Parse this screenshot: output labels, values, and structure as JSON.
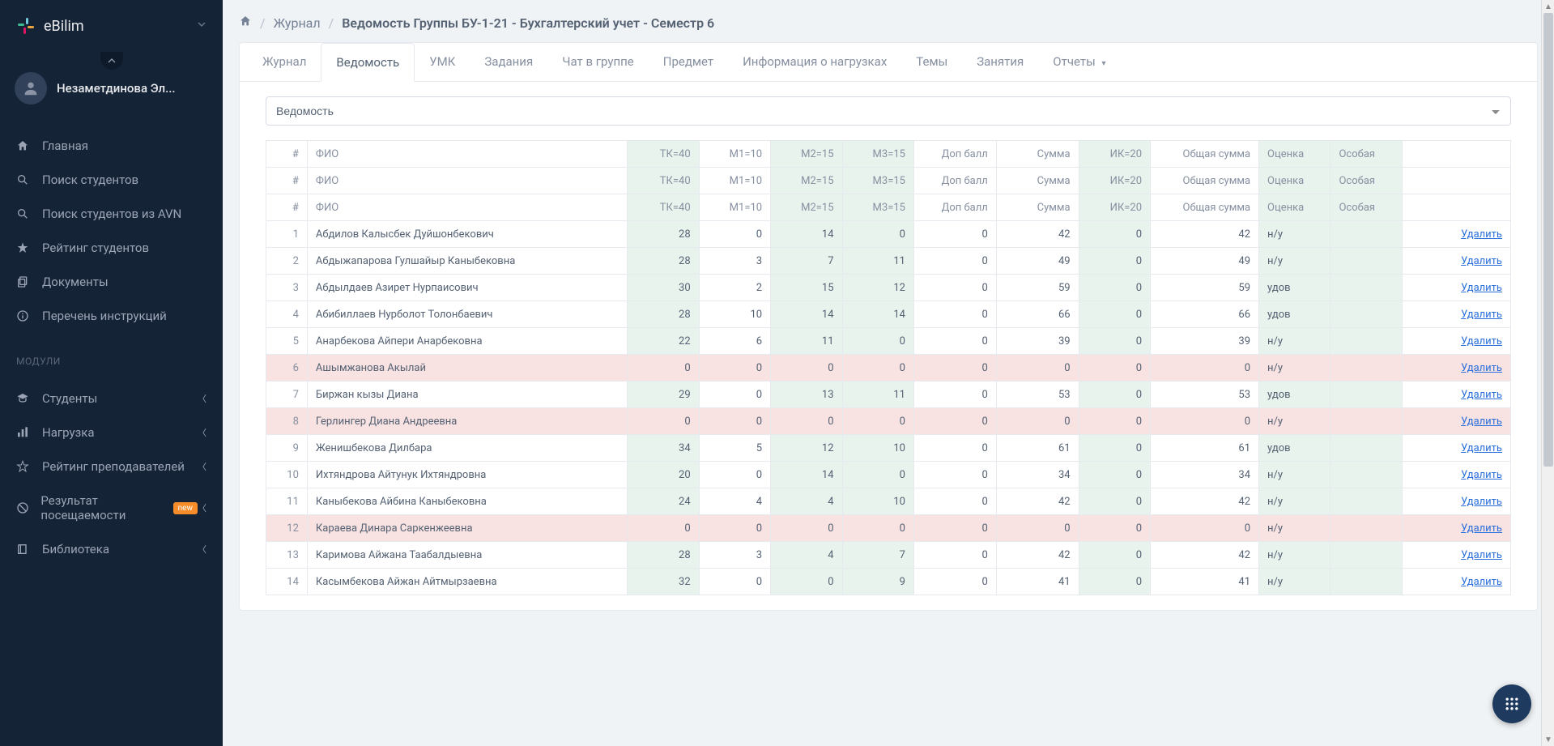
{
  "brand": {
    "name": "eBilim"
  },
  "user": {
    "name": "Незаметдинова Эл..."
  },
  "sidebar": {
    "items": [
      {
        "icon": "home",
        "label": "Главная"
      },
      {
        "icon": "search",
        "label": "Поиск студентов"
      },
      {
        "icon": "search",
        "label": "Поиск студентов из AVN"
      },
      {
        "icon": "star",
        "label": "Рейтинг студентов"
      },
      {
        "icon": "copy",
        "label": "Документы"
      },
      {
        "icon": "info",
        "label": "Перечень инструкций"
      }
    ],
    "section_label": "МОДУЛИ",
    "modules": [
      {
        "icon": "grad",
        "label": "Студенты",
        "arrow": true
      },
      {
        "icon": "chart",
        "label": "Нагрузка",
        "arrow": true
      },
      {
        "icon": "star-o",
        "label": "Рейтинг преподавателей",
        "arrow": true
      },
      {
        "icon": "ban",
        "label": "Результат посещаемости",
        "arrow": true,
        "badge": "new"
      },
      {
        "icon": "book",
        "label": "Библиотека",
        "arrow": true
      }
    ]
  },
  "breadcrumb": {
    "item1": "Журнал",
    "item2": "Ведомость Группы БУ-1-21 - Бухгалтерский учет - Семестр 6"
  },
  "tabs": [
    {
      "label": "Журнал"
    },
    {
      "label": "Ведомость",
      "active": true
    },
    {
      "label": "УМК"
    },
    {
      "label": "Задания"
    },
    {
      "label": "Чат в группе"
    },
    {
      "label": "Предмет"
    },
    {
      "label": "Информация о нагрузках"
    },
    {
      "label": "Темы"
    },
    {
      "label": "Занятия"
    },
    {
      "label": "Отчеты",
      "dropdown": true
    }
  ],
  "select": {
    "value": "Ведомость"
  },
  "table": {
    "headers": {
      "num": "#",
      "fio": "ФИО",
      "tk": "ТК=40",
      "m1": "М1=10",
      "m2": "М2=15",
      "m3": "М3=15",
      "dop": "Доп балл",
      "sum": "Сумма",
      "ik": "ИК=20",
      "total": "Общая сумма",
      "grade": "Оценка",
      "special": "Особая"
    },
    "delete_label": "Удалить",
    "rows": [
      {
        "n": 1,
        "name": "Абдилов Калысбек Дуйшонбекович",
        "tk": 28,
        "m1": 0,
        "m2": 14,
        "m3": 0,
        "dop": 0,
        "sum": 42,
        "ik": 0,
        "total": 42,
        "grade": "н/у",
        "pink": false
      },
      {
        "n": 2,
        "name": "Абдыжапарова Гулшайыр Каныбековна",
        "tk": 28,
        "m1": 3,
        "m2": 7,
        "m3": 11,
        "dop": 0,
        "sum": 49,
        "ik": 0,
        "total": 49,
        "grade": "н/у",
        "pink": false
      },
      {
        "n": 3,
        "name": "Абдылдаев Азирет Нурпаисович",
        "tk": 30,
        "m1": 2,
        "m2": 15,
        "m3": 12,
        "dop": 0,
        "sum": 59,
        "ik": 0,
        "total": 59,
        "grade": "удов",
        "pink": false
      },
      {
        "n": 4,
        "name": "Абибиллаев Нурболот Толонбаевич",
        "tk": 28,
        "m1": 10,
        "m2": 14,
        "m3": 14,
        "dop": 0,
        "sum": 66,
        "ik": 0,
        "total": 66,
        "grade": "удов",
        "pink": false
      },
      {
        "n": 5,
        "name": "Анарбекова Айпери Анарбековна",
        "tk": 22,
        "m1": 6,
        "m2": 11,
        "m3": 0,
        "dop": 0,
        "sum": 39,
        "ik": 0,
        "total": 39,
        "grade": "н/у",
        "pink": false
      },
      {
        "n": 6,
        "name": "Ашымжанова Акылай",
        "tk": 0,
        "m1": 0,
        "m2": 0,
        "m3": 0,
        "dop": 0,
        "sum": 0,
        "ik": 0,
        "total": 0,
        "grade": "н/у",
        "pink": true
      },
      {
        "n": 7,
        "name": "Биржан кызы Диана",
        "tk": 29,
        "m1": 0,
        "m2": 13,
        "m3": 11,
        "dop": 0,
        "sum": 53,
        "ik": 0,
        "total": 53,
        "grade": "удов",
        "pink": false
      },
      {
        "n": 8,
        "name": "Герлингер Диана Андреевна",
        "tk": 0,
        "m1": 0,
        "m2": 0,
        "m3": 0,
        "dop": 0,
        "sum": 0,
        "ik": 0,
        "total": 0,
        "grade": "н/у",
        "pink": true
      },
      {
        "n": 9,
        "name": "Женишбекова Дилбара",
        "tk": 34,
        "m1": 5,
        "m2": 12,
        "m3": 10,
        "dop": 0,
        "sum": 61,
        "ik": 0,
        "total": 61,
        "grade": "удов",
        "pink": false
      },
      {
        "n": 10,
        "name": "Ихтяндрова Айтунук Ихтяндровна",
        "tk": 20,
        "m1": 0,
        "m2": 14,
        "m3": 0,
        "dop": 0,
        "sum": 34,
        "ik": 0,
        "total": 34,
        "grade": "н/у",
        "pink": false
      },
      {
        "n": 11,
        "name": "Каныбекова Айбина Каныбековна",
        "tk": 24,
        "m1": 4,
        "m2": 4,
        "m3": 10,
        "dop": 0,
        "sum": 42,
        "ik": 0,
        "total": 42,
        "grade": "н/у",
        "pink": false
      },
      {
        "n": 12,
        "name": "Караева Динара Саркенжеевна",
        "tk": 0,
        "m1": 0,
        "m2": 0,
        "m3": 0,
        "dop": 0,
        "sum": 0,
        "ik": 0,
        "total": 0,
        "grade": "н/у",
        "pink": true
      },
      {
        "n": 13,
        "name": "Каримова Айжана Таабалдыевна",
        "tk": 28,
        "m1": 3,
        "m2": 4,
        "m3": 7,
        "dop": 0,
        "sum": 42,
        "ik": 0,
        "total": 42,
        "grade": "н/у",
        "pink": false
      },
      {
        "n": 14,
        "name": "Касымбекова Айжан Айтмырзаевна",
        "tk": 32,
        "m1": 0,
        "m2": 0,
        "m3": 9,
        "dop": 0,
        "sum": 41,
        "ik": 0,
        "total": 41,
        "grade": "н/у",
        "pink": false
      }
    ]
  }
}
